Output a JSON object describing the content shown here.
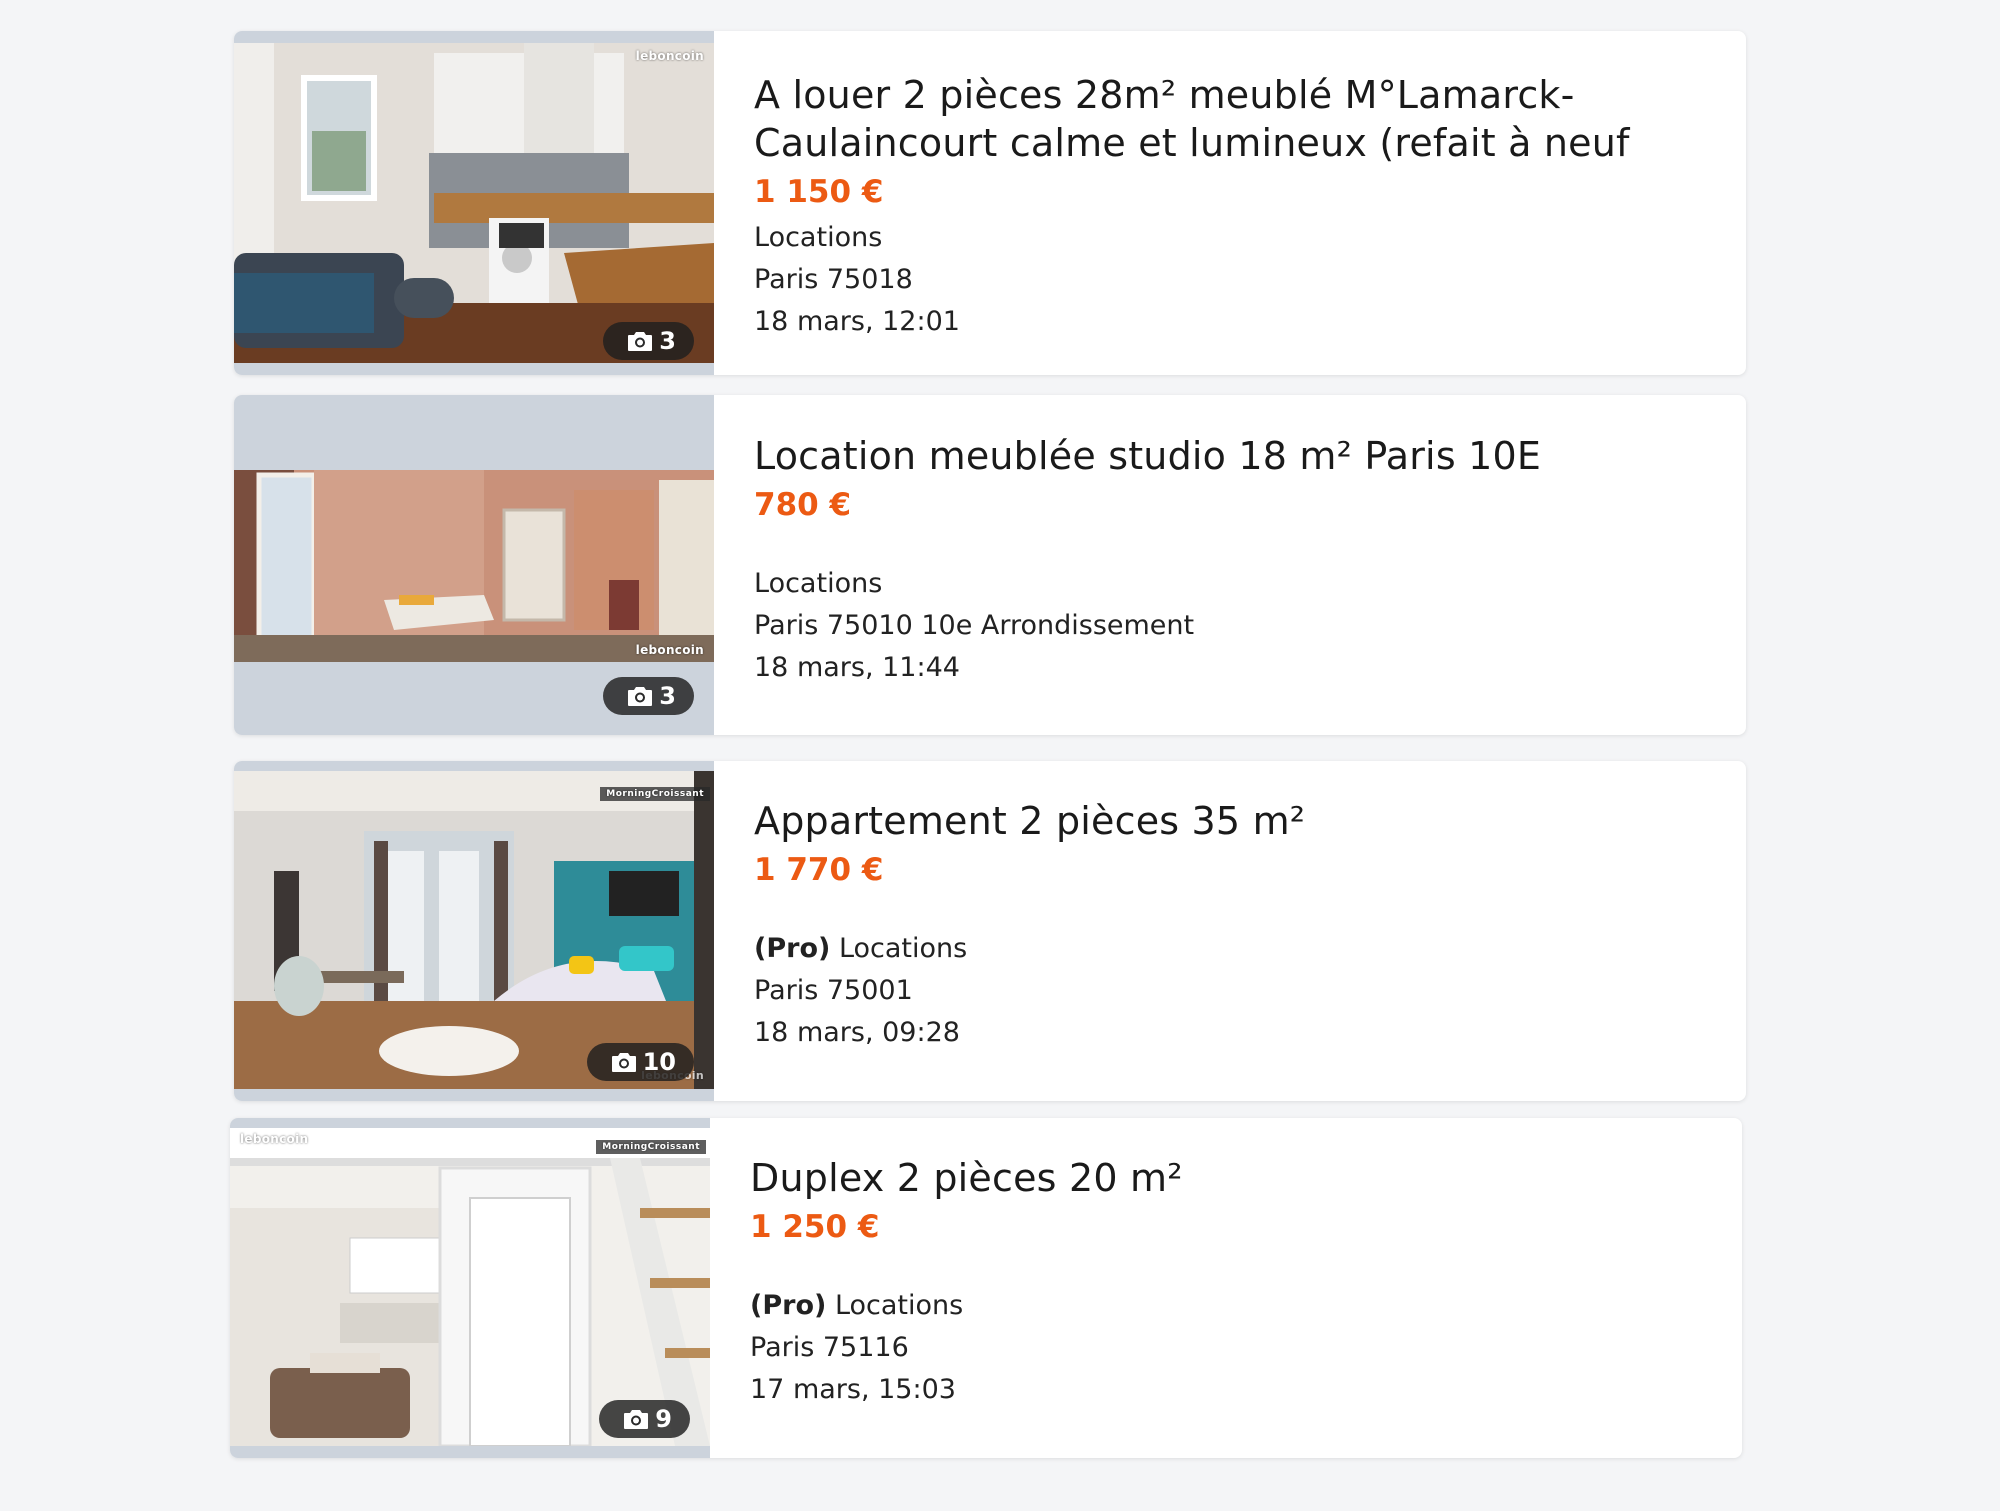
{
  "listings": [
    {
      "title": "A louer 2 pièces 28m² meublé M°Lamarck-Caulaincourt calme et lumineux (refait à neuf",
      "price": "1 150 €",
      "pro": "",
      "category": "Locations",
      "location": "Paris 75018",
      "date": "18 mars, 12:01",
      "photo_count": "3",
      "watermark": "leboncoin"
    },
    {
      "title": "Location meublée studio 18 m² Paris 10E",
      "price": "780 €",
      "pro": "",
      "category": "Locations",
      "location": "Paris 75010 10e Arrondissement",
      "date": "18 mars, 11:44",
      "photo_count": "3",
      "watermark": "leboncoin"
    },
    {
      "title": "Appartement 2 pièces 35 m²",
      "price": "1 770 €",
      "pro": "(Pro)",
      "category": "Locations",
      "location": "Paris 75001",
      "date": "18 mars, 09:28",
      "photo_count": "10",
      "watermark": "MorningCroissant",
      "watermark2": "leboncoin"
    },
    {
      "title": "Duplex 2 pièces 20 m²",
      "price": "1 250 €",
      "pro": "(Pro)",
      "category": "Locations",
      "location": "Paris 75116",
      "date": "17 mars, 15:03",
      "photo_count": "9",
      "watermark": "MorningCroissant",
      "watermark2": "leboncoin"
    }
  ],
  "colors": {
    "price": "#ec5a13",
    "background": "#f4f5f7",
    "card": "#ffffff",
    "thumb_placeholder": "#ccd3dc"
  },
  "icons": {
    "photo_count": "camera-icon"
  }
}
